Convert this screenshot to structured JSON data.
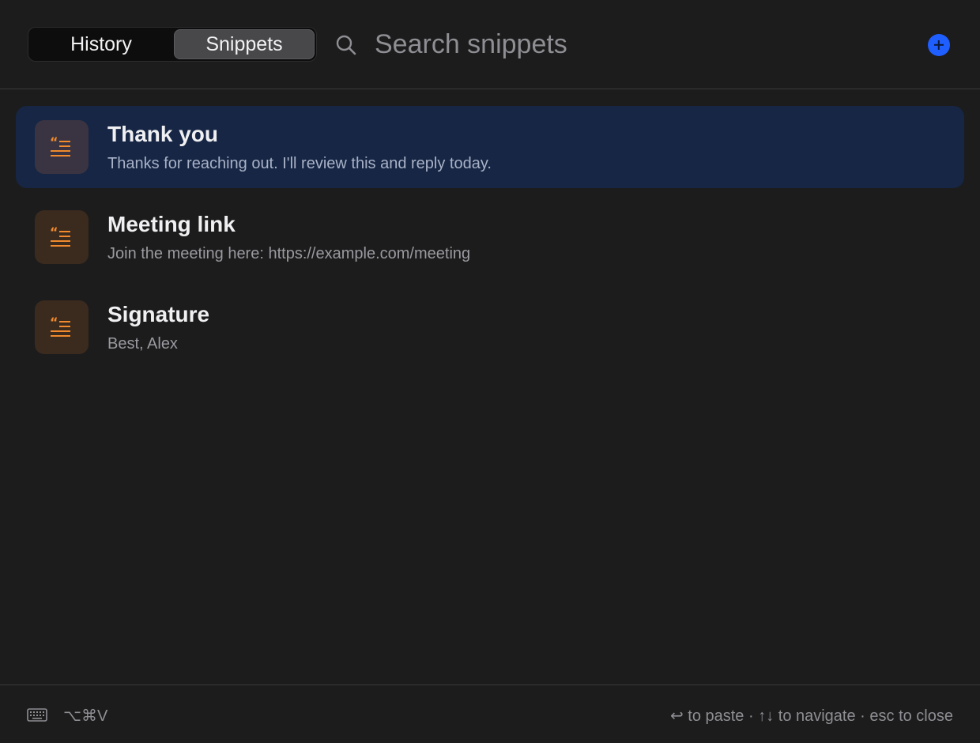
{
  "header": {
    "tabs": [
      {
        "label": "History",
        "selected": false
      },
      {
        "label": "Snippets",
        "selected": true
      }
    ],
    "search": {
      "placeholder": "Search snippets",
      "value": "",
      "icon": "search-icon"
    },
    "add_button": {
      "icon": "plus-circle-icon",
      "color": "#1f5eff"
    }
  },
  "snippets": [
    {
      "title": "Thank you",
      "preview": "Thanks for reaching out. I'll review this and reply today.",
      "selected": true,
      "icon": "quote-text-icon"
    },
    {
      "title": "Meeting link",
      "preview": "Join the meeting here: https://example.com/meeting",
      "selected": false,
      "icon": "quote-text-icon"
    },
    {
      "title": "Signature",
      "preview": "Best, Alex",
      "selected": false,
      "icon": "quote-text-icon"
    }
  ],
  "footer": {
    "keyboard_icon": "keyboard-icon",
    "shortcut": "⌥⌘V",
    "hints": "↩ to paste · ↑↓ to navigate · esc to close"
  },
  "colors": {
    "background": "#1c1c1d",
    "selection": "#162644",
    "accent": "#1f5eff",
    "snippet_icon": "#f08a2c"
  }
}
